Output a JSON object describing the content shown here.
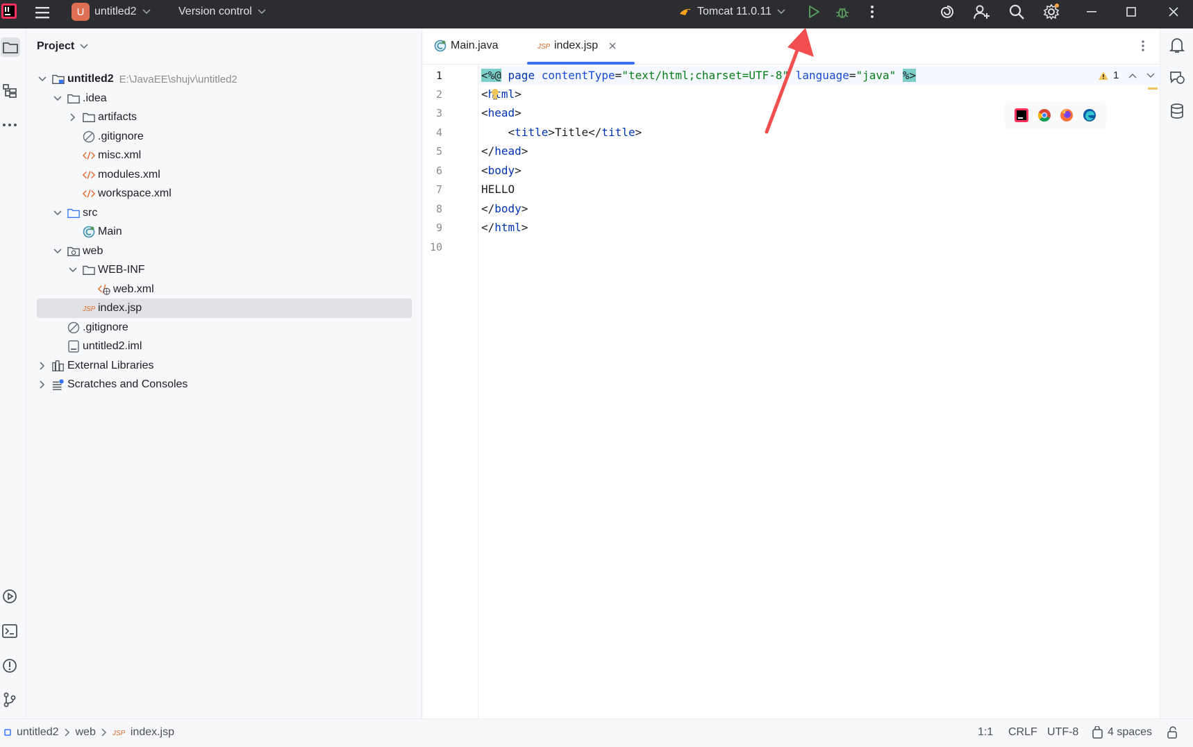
{
  "titlebar": {
    "project_badge": "U",
    "project_name": "untitled2",
    "version_control": "Version control",
    "run_config": "Tomcat 11.0.11"
  },
  "project_panel": {
    "title": "Project",
    "tree": [
      {
        "label": "untitled2",
        "hint": "E:\\JavaEE\\shujv\\untitled2",
        "icon": "module-folder-icon",
        "expanded": true
      },
      {
        "label": ".idea",
        "icon": "folder-icon",
        "expanded": true
      },
      {
        "label": "artifacts",
        "icon": "folder-icon",
        "expanded": false
      },
      {
        "label": ".gitignore",
        "icon": "ignore-file-icon"
      },
      {
        "label": "misc.xml",
        "icon": "xml-file-icon"
      },
      {
        "label": "modules.xml",
        "icon": "xml-file-icon"
      },
      {
        "label": "workspace.xml",
        "icon": "xml-file-icon"
      },
      {
        "label": "src",
        "icon": "source-folder-icon",
        "expanded": true
      },
      {
        "label": "Main",
        "icon": "java-class-icon"
      },
      {
        "label": "web",
        "icon": "web-folder-icon",
        "expanded": true
      },
      {
        "label": "WEB-INF",
        "icon": "folder-icon",
        "expanded": true
      },
      {
        "label": "web.xml",
        "icon": "web-xml-icon"
      },
      {
        "label": "index.jsp",
        "icon": "jsp-file-icon",
        "selected": true
      },
      {
        "label": ".gitignore",
        "icon": "ignore-file-icon"
      },
      {
        "label": "untitled2.iml",
        "icon": "iml-file-icon"
      },
      {
        "label": "External Libraries",
        "icon": "libraries-icon",
        "expanded": false
      },
      {
        "label": "Scratches and Consoles",
        "icon": "scratches-icon",
        "expanded": false
      }
    ]
  },
  "editor": {
    "tabs": [
      {
        "label": "Main.java",
        "icon": "java-class-icon"
      },
      {
        "label": "index.jsp",
        "icon": "jsp-file-icon",
        "active": true
      }
    ],
    "line_numbers": [
      "1",
      "2",
      "3",
      "4",
      "5",
      "6",
      "7",
      "8",
      "9",
      "10"
    ],
    "code": {
      "l1": {
        "open": "<%@",
        "kw": " page ",
        "attr1": "contentType",
        "eq": "=",
        "val1": "\"text/html;charset=UTF-8\"",
        "attr2": " language",
        "eq2": "=",
        "val2": "\"java\"",
        "close": "%>"
      },
      "l2": {
        "lt": "<",
        "tag": "html",
        "gt": ">"
      },
      "l3": {
        "lt": "<",
        "tag": "head",
        "gt": ">"
      },
      "l4": {
        "indent": "    ",
        "lt": "<",
        "tag": "title",
        "gt": ">",
        "text": "Title",
        "lt2": "</",
        "tag2": "title",
        "gt2": ">"
      },
      "l5": {
        "lt": "</",
        "tag": "head",
        "gt": ">"
      },
      "l6": {
        "lt": "<",
        "tag": "body",
        "gt": ">"
      },
      "l7": {
        "text": "HELLO"
      },
      "l8": {
        "lt": "</",
        "tag": "body",
        "gt": ">"
      },
      "l9": {
        "lt": "</",
        "tag": "html",
        "gt": ">"
      }
    },
    "warning_count": "1"
  },
  "statusbar": {
    "breadcrumb": [
      "untitled2",
      "web",
      "index.jsp"
    ],
    "position": "1:1",
    "line_sep": "CRLF",
    "encoding": "UTF-8",
    "indent": "4 spaces"
  },
  "colors": {
    "accent": "#3574f0",
    "run_green": "#57965c",
    "arrow_red": "#f24e4e",
    "jsp_orange": "#e06c2b"
  }
}
